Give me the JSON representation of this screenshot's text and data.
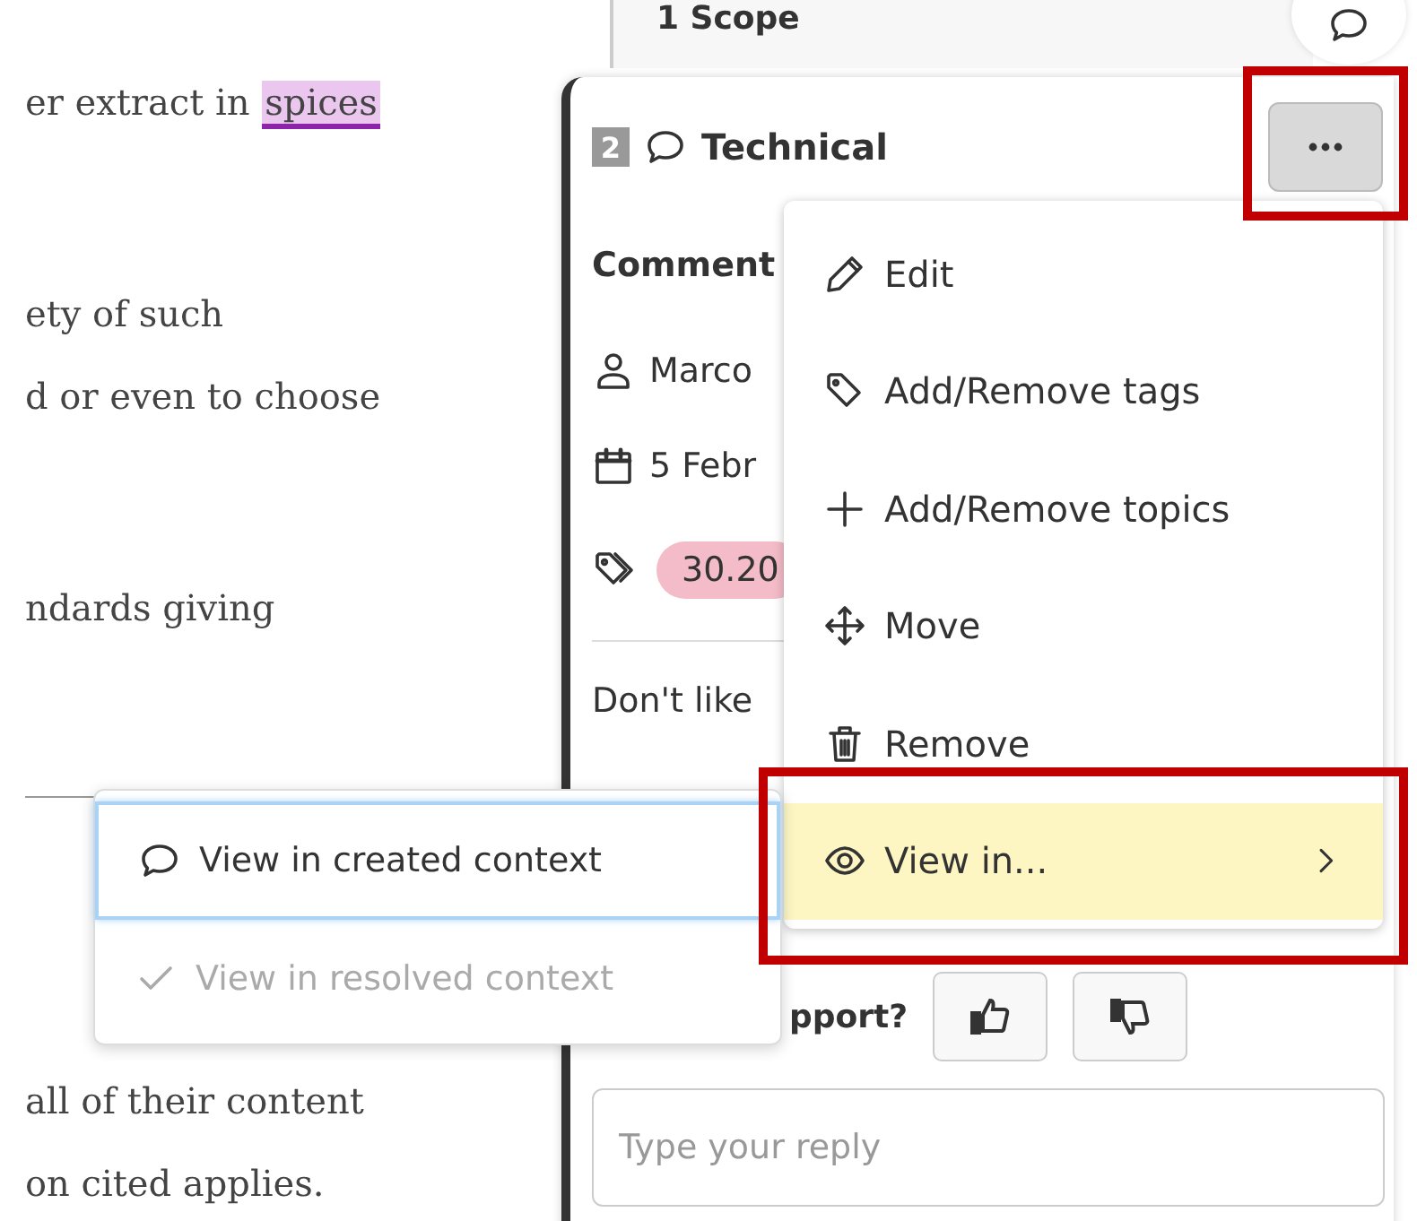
{
  "document": {
    "lines": [
      {
        "text": "er extract in ",
        "highlight": "spices"
      },
      {
        "text": "ety of such"
      },
      {
        "text": "d or even to choose"
      },
      {
        "text": "ndards giving"
      },
      {
        "text": "all of their content"
      },
      {
        "text": "on cited applies."
      }
    ]
  },
  "background_card": {
    "title": "1 Scope"
  },
  "comment_card": {
    "number": "2",
    "type": "Technical",
    "heading": "Comment",
    "author": "Marco",
    "date": "5 Febr",
    "tag": "30.20",
    "body": "Don't like",
    "support_label": "pport?",
    "reply": {
      "placeholder": "Type your reply"
    }
  },
  "menu": {
    "items": [
      {
        "label": "Edit",
        "selected": false
      },
      {
        "label": "Add/Remove tags",
        "selected": false
      },
      {
        "label": "Add/Remove topics",
        "selected": false
      },
      {
        "label": "Move",
        "selected": false
      },
      {
        "label": "Remove",
        "selected": false
      },
      {
        "label": "View in...",
        "selected": true,
        "has_submenu": true
      }
    ]
  },
  "submenu": {
    "items": [
      {
        "label": "View in created context",
        "selected": true,
        "disabled": false
      },
      {
        "label": "View in resolved context",
        "selected": false,
        "disabled": true
      }
    ]
  }
}
